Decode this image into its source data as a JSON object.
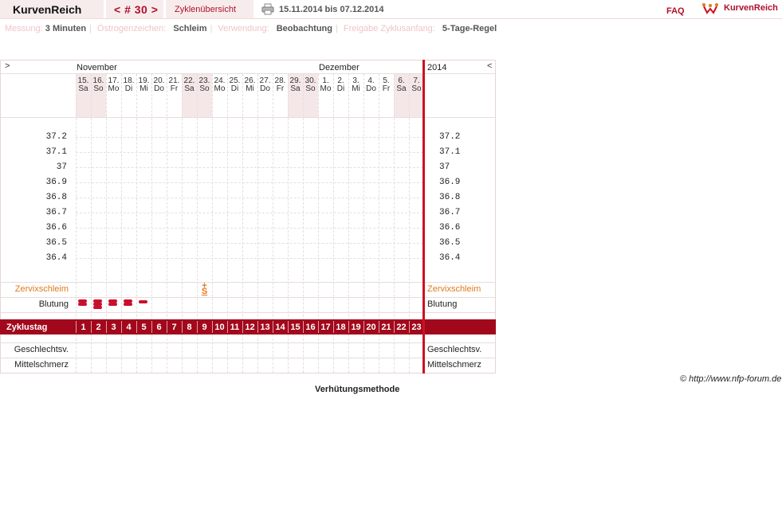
{
  "header": {
    "brand": "KurvenReich",
    "cycle_label": "< # 30 >",
    "overview_label": "Zyklenübersicht",
    "date_range": "15.11.2014 bis 07.12.2014",
    "faq_label": "FAQ",
    "logo_text": "KurvenReich",
    "printer_icon": "printer-icon",
    "logo_icon": "kurvenreich-logo-icon"
  },
  "settings": {
    "messung_label": "Messung:",
    "messung_value": "3 Minuten",
    "oestrogen_label": "Östrogenzeichen:",
    "oestrogen_value": "Schleim",
    "verwendung_label": "Verwendung:",
    "verwendung_value": "Beobachtung",
    "freigabe_label": "Freigabe Zyklusanfang:",
    "freigabe_value": "5-Tage-Regel"
  },
  "chart": {
    "nav_left": ">",
    "nav_right": "<",
    "month_left": "November",
    "month_right": "Dezember",
    "year": "2014",
    "days": [
      {
        "date": "15.",
        "wd": "Sa",
        "weekend": true
      },
      {
        "date": "16.",
        "wd": "So",
        "weekend": true
      },
      {
        "date": "17.",
        "wd": "Mo",
        "weekend": false
      },
      {
        "date": "18.",
        "wd": "Di",
        "weekend": false
      },
      {
        "date": "19.",
        "wd": "Mi",
        "weekend": false
      },
      {
        "date": "20.",
        "wd": "Do",
        "weekend": false
      },
      {
        "date": "21.",
        "wd": "Fr",
        "weekend": false
      },
      {
        "date": "22.",
        "wd": "Sa",
        "weekend": true
      },
      {
        "date": "23.",
        "wd": "So",
        "weekend": true
      },
      {
        "date": "24.",
        "wd": "Mo",
        "weekend": false
      },
      {
        "date": "25.",
        "wd": "Di",
        "weekend": false
      },
      {
        "date": "26.",
        "wd": "Mi",
        "weekend": false
      },
      {
        "date": "27.",
        "wd": "Do",
        "weekend": false
      },
      {
        "date": "28.",
        "wd": "Fr",
        "weekend": false
      },
      {
        "date": "29.",
        "wd": "Sa",
        "weekend": true
      },
      {
        "date": "30.",
        "wd": "So",
        "weekend": true
      },
      {
        "date": "1.",
        "wd": "Mo",
        "weekend": false
      },
      {
        "date": "2.",
        "wd": "Di",
        "weekend": false
      },
      {
        "date": "3.",
        "wd": "Mi",
        "weekend": false
      },
      {
        "date": "4.",
        "wd": "Do",
        "weekend": false
      },
      {
        "date": "5.",
        "wd": "Fr",
        "weekend": false
      },
      {
        "date": "6.",
        "wd": "Sa",
        "weekend": true
      },
      {
        "date": "7.",
        "wd": "So",
        "weekend": true
      }
    ],
    "temps": [
      "37.2",
      "37.1",
      "37",
      "36.9",
      "36.8",
      "36.7",
      "36.6",
      "36.5",
      "36.4"
    ],
    "zervix_label": "Zervixschleim",
    "zervix_symbol_top": "+",
    "zervix_symbol_bottom": "S",
    "zervix_day": 9,
    "blutung_label": "Blutung",
    "bleeding": [
      {
        "day": 1,
        "level": 2
      },
      {
        "day": 2,
        "level": 3
      },
      {
        "day": 3,
        "level": 2
      },
      {
        "day": 4,
        "level": 2
      },
      {
        "day": 5,
        "level": 1
      }
    ],
    "zyklustag_label": "Zyklustag",
    "cycle_days": [
      "1",
      "2",
      "3",
      "4",
      "5",
      "6",
      "7",
      "8",
      "9",
      "10",
      "11",
      "12",
      "13",
      "14",
      "15",
      "16",
      "17",
      "18",
      "19",
      "20",
      "21",
      "22",
      "23"
    ],
    "geschlechtsv_label": "Geschlechtsv.",
    "mittelschmerz_label": "Mittelschmerz",
    "colors": {
      "accent": "#b0102a",
      "zyklus_bar": "#a2081c",
      "weekend": "#f5e7e8",
      "zervix": "#e07a1a",
      "bleeding": "#c8102e"
    }
  },
  "footer": {
    "copyright": "© http://www.nfp-forum.de",
    "method": "Verhütungsmethode"
  }
}
